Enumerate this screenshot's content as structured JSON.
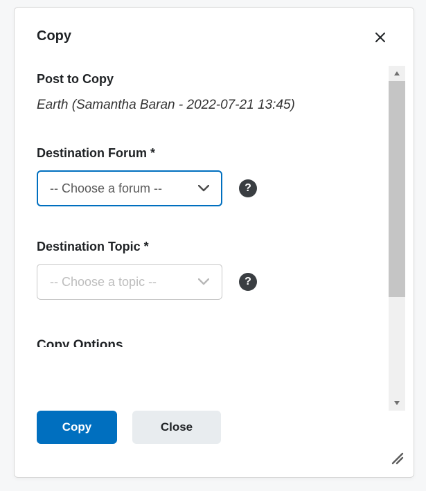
{
  "dialog": {
    "title": "Copy",
    "post_to_copy_label": "Post to Copy",
    "post_name": "Earth (Samantha Baran - 2022-07-21 13:45)",
    "dest_forum_label": "Destination Forum *",
    "dest_forum_placeholder": "-- Choose a forum --",
    "dest_topic_label": "Destination Topic *",
    "dest_topic_placeholder": "-- Choose a topic --",
    "cutoff_section": "Copy Options",
    "copy_button": "Copy",
    "close_button": "Close"
  }
}
